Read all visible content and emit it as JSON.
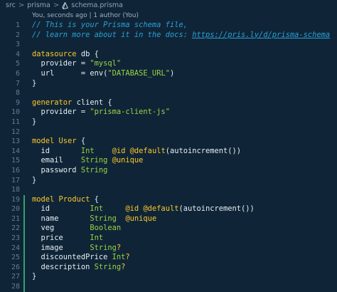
{
  "breadcrumb": {
    "items": [
      "src",
      "prisma",
      "schema.prisma"
    ],
    "separator": ">"
  },
  "blame": "You, seconds ago | 1 author (You)",
  "colors": {
    "background": "#0f2537",
    "comment": "#2aa1d6",
    "keyword": "#fdc72c",
    "type": "#9ad145",
    "string": "#9ad145",
    "text": "#e6edf3",
    "line_number": "#627b91",
    "git_added": "#2fa36b"
  },
  "lines": [
    {
      "n": "1",
      "tokens": [
        {
          "t": "// This is your Prisma schema file,",
          "c": "comment"
        }
      ]
    },
    {
      "n": "2",
      "tokens": [
        {
          "t": "// learn more about it in the docs: ",
          "c": "comment"
        },
        {
          "t": "https://pris.ly/d/prisma-schema",
          "c": "link"
        }
      ]
    },
    {
      "n": "3",
      "tokens": []
    },
    {
      "n": "4",
      "tokens": [
        {
          "t": "datasource ",
          "c": "kw"
        },
        {
          "t": "db ",
          "c": "ident"
        },
        {
          "t": "{",
          "c": "punct"
        }
      ]
    },
    {
      "n": "5",
      "tokens": [
        {
          "t": "  provider ",
          "c": "ident"
        },
        {
          "t": "= ",
          "c": "punct"
        },
        {
          "t": "\"mysql\"",
          "c": "string"
        }
      ]
    },
    {
      "n": "6",
      "tokens": [
        {
          "t": "  url      ",
          "c": "ident"
        },
        {
          "t": "= ",
          "c": "punct"
        },
        {
          "t": "env(",
          "c": "func"
        },
        {
          "t": "\"DATABASE_URL\"",
          "c": "string"
        },
        {
          "t": ")",
          "c": "punct"
        }
      ]
    },
    {
      "n": "7",
      "tokens": [
        {
          "t": "}",
          "c": "punct"
        }
      ]
    },
    {
      "n": "8",
      "tokens": []
    },
    {
      "n": "9",
      "tokens": [
        {
          "t": "generator ",
          "c": "kw"
        },
        {
          "t": "client ",
          "c": "ident"
        },
        {
          "t": "{",
          "c": "punct"
        }
      ]
    },
    {
      "n": "10",
      "tokens": [
        {
          "t": "  provider ",
          "c": "ident"
        },
        {
          "t": "= ",
          "c": "punct"
        },
        {
          "t": "\"prisma-client-js\"",
          "c": "string"
        }
      ]
    },
    {
      "n": "11",
      "tokens": [
        {
          "t": "}",
          "c": "punct"
        }
      ]
    },
    {
      "n": "12",
      "tokens": []
    },
    {
      "n": "13",
      "tokens": [
        {
          "t": "model ",
          "c": "kw"
        },
        {
          "t": "User ",
          "c": "kw"
        },
        {
          "t": "{",
          "c": "punct"
        }
      ]
    },
    {
      "n": "14",
      "tokens": [
        {
          "t": "  id       ",
          "c": "ident"
        },
        {
          "t": "Int",
          "c": "type"
        },
        {
          "t": "    ",
          "c": "plain"
        },
        {
          "t": "@id @default",
          "c": "kw"
        },
        {
          "t": "(autoincrement())",
          "c": "punct"
        }
      ]
    },
    {
      "n": "15",
      "tokens": [
        {
          "t": "  email    ",
          "c": "ident"
        },
        {
          "t": "String ",
          "c": "type"
        },
        {
          "t": "@unique",
          "c": "kw"
        }
      ]
    },
    {
      "n": "16",
      "tokens": [
        {
          "t": "  password ",
          "c": "ident"
        },
        {
          "t": "String",
          "c": "type"
        }
      ]
    },
    {
      "n": "17",
      "tokens": [
        {
          "t": "}",
          "c": "punct"
        }
      ]
    },
    {
      "n": "18",
      "tokens": []
    },
    {
      "n": "19",
      "added": true,
      "tokens": [
        {
          "t": "model ",
          "c": "kw"
        },
        {
          "t": "Product ",
          "c": "kw"
        },
        {
          "t": "{",
          "c": "punct"
        }
      ]
    },
    {
      "n": "20",
      "added": true,
      "tokens": [
        {
          "t": "  id         ",
          "c": "ident"
        },
        {
          "t": "Int",
          "c": "type"
        },
        {
          "t": "     ",
          "c": "plain"
        },
        {
          "t": "@id @default",
          "c": "kw"
        },
        {
          "t": "(autoincrement())",
          "c": "punct"
        }
      ]
    },
    {
      "n": "21",
      "added": true,
      "tokens": [
        {
          "t": "  name       ",
          "c": "ident"
        },
        {
          "t": "String  ",
          "c": "type"
        },
        {
          "t": "@unique",
          "c": "kw"
        }
      ]
    },
    {
      "n": "22",
      "added": true,
      "tokens": [
        {
          "t": "  veg        ",
          "c": "ident"
        },
        {
          "t": "Boolean",
          "c": "type"
        }
      ]
    },
    {
      "n": "23",
      "added": true,
      "tokens": [
        {
          "t": "  price      ",
          "c": "ident"
        },
        {
          "t": "Int",
          "c": "type"
        }
      ]
    },
    {
      "n": "24",
      "added": true,
      "tokens": [
        {
          "t": "  image      ",
          "c": "ident"
        },
        {
          "t": "String",
          "c": "type"
        },
        {
          "t": "?",
          "c": "q"
        }
      ]
    },
    {
      "n": "25",
      "added": true,
      "tokens": [
        {
          "t": "  discountedPrice ",
          "c": "ident"
        },
        {
          "t": "Int",
          "c": "type"
        },
        {
          "t": "?",
          "c": "q"
        }
      ]
    },
    {
      "n": "26",
      "added": true,
      "tokens": [
        {
          "t": "  description ",
          "c": "ident"
        },
        {
          "t": "String",
          "c": "type"
        },
        {
          "t": "?",
          "c": "q"
        }
      ]
    },
    {
      "n": "27",
      "added": true,
      "tokens": [
        {
          "t": "}",
          "c": "punct"
        }
      ]
    },
    {
      "n": "28",
      "added": true,
      "tokens": []
    }
  ]
}
